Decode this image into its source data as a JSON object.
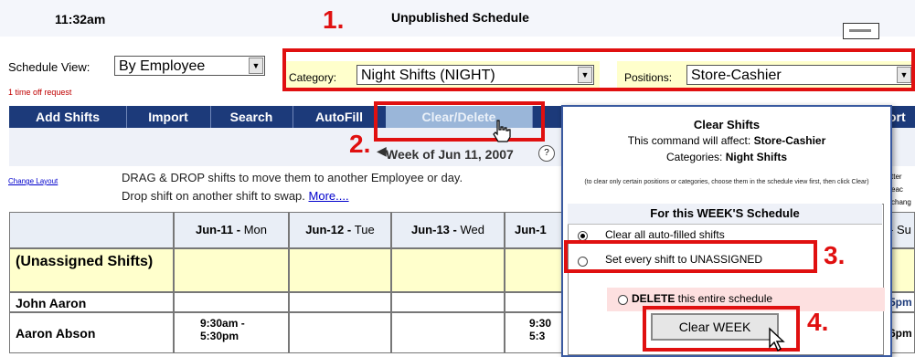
{
  "header": {
    "time": "11:32am",
    "title": "Unpublished Schedule"
  },
  "schedule_view": {
    "label": "Schedule View:",
    "value": "By Employee"
  },
  "time_off_request": "1 time off request",
  "category": {
    "label": "Category:",
    "value": "Night Shifts (NIGHT)"
  },
  "positions": {
    "label": "Positions:",
    "value": "Store-Cashier"
  },
  "nav": {
    "add_shifts": "Add Shifts",
    "import": "Import",
    "search": "Search",
    "autofill": "AutoFill",
    "clear_delete": "Clear/Delete",
    "report": "ort"
  },
  "week_label": "Week of Jun 11, 2007",
  "change_layout": "Change Layout",
  "drag_text_line1": "DRAG & DROP shifts to move them to another Employee or day.",
  "drag_text_line2": "Drop shift on another shift to swap.",
  "more_link": "More....",
  "table": {
    "columns": [
      {
        "date": "Jun-11",
        "day": "Mon"
      },
      {
        "date": "Jun-12",
        "day": "Tue"
      },
      {
        "date": "Jun-13",
        "day": "Wed"
      },
      {
        "date": "Jun-1",
        "day": ""
      }
    ],
    "sun_col": "- Su",
    "rows": [
      {
        "name": "(Unassigned Shifts)"
      },
      {
        "name": "John Aaron",
        "right": "5pm"
      },
      {
        "name": "Aaron Abson",
        "mon": "9:30am - 5:30pm",
        "thu": "9:30 5:3",
        "right": "6pm"
      }
    ],
    "right_partial": "tter eac chang"
  },
  "dialog": {
    "title": "Clear Shifts",
    "affect_prefix": "This command will affect: ",
    "affect_value": "Store-Cashier",
    "categories_prefix": "Categories: ",
    "categories_value": "Night Shifts",
    "note": "(to clear only certain positions or categories, choose them in the schedule view first, then click Clear)",
    "week_title": "For this WEEK'S Schedule",
    "option1": "Clear all auto-filled shifts",
    "option2": "Set every shift to UNASSIGNED",
    "option3_bold": "DELETE",
    "option3_rest": " this entire schedule",
    "clear_button": "Clear WEEK"
  },
  "annotations": {
    "n1": "1.",
    "n2": "2.",
    "n3": "3.",
    "n4": "4.",
    "color": "#e01010"
  }
}
